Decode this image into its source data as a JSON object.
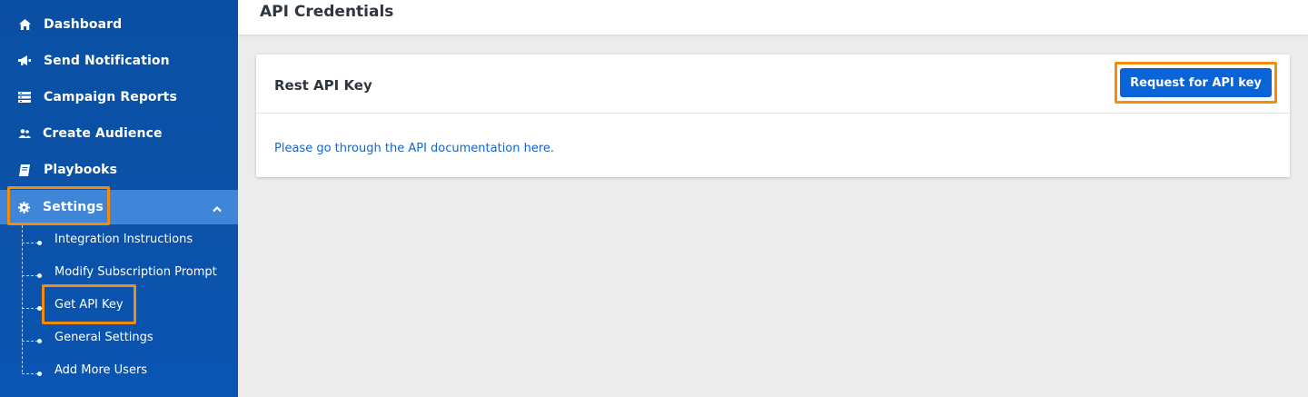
{
  "sidebar": {
    "items": [
      {
        "label": "Dashboard",
        "icon": "home-icon"
      },
      {
        "label": "Send Notification",
        "icon": "megaphone-icon"
      },
      {
        "label": "Campaign Reports",
        "icon": "reports-icon"
      },
      {
        "label": "Create Audience",
        "icon": "audience-icon"
      },
      {
        "label": "Playbooks",
        "icon": "book-icon"
      },
      {
        "label": "Settings",
        "icon": "gear-icon",
        "expanded": true
      }
    ],
    "settings_subitems": [
      {
        "label": "Integration Instructions"
      },
      {
        "label": "Modify Subscription Prompt"
      },
      {
        "label": "Get API Key",
        "highlighted": true
      },
      {
        "label": "General Settings"
      },
      {
        "label": "Add More Users"
      }
    ]
  },
  "header": {
    "title": "API Credentials"
  },
  "card": {
    "title": "Rest API Key",
    "request_button_label": "Request for API key",
    "doc_link_text": "Please go through the API documentation here."
  },
  "colors": {
    "sidebar_bg": "#0b52a8",
    "active_item_bg": "#3f86d8",
    "highlight": "#f28c0f",
    "primary_button": "#0b63d8",
    "link": "#1566c9"
  }
}
